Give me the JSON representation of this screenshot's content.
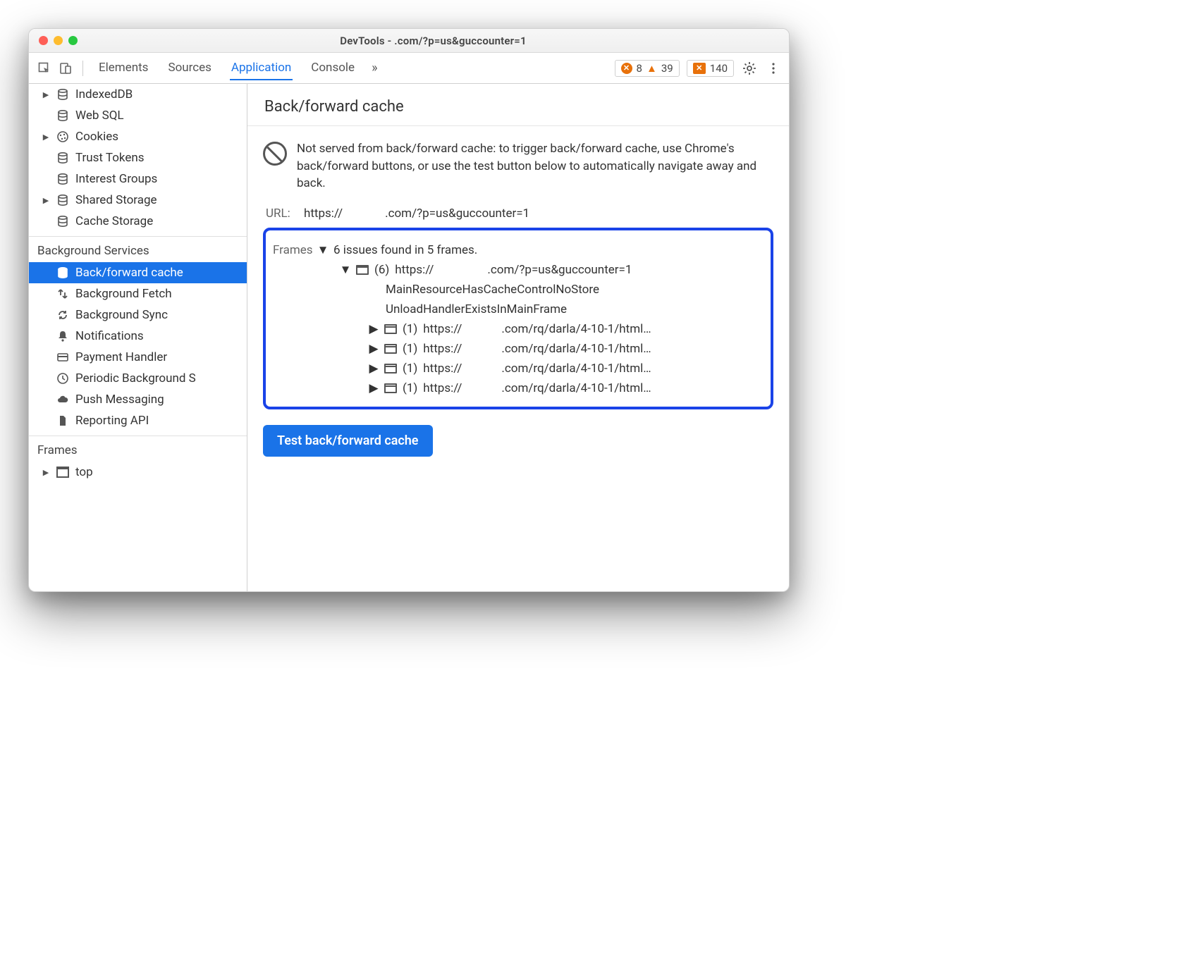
{
  "window": {
    "title": "DevTools -         .com/?p=us&guccounter=1"
  },
  "toolbar": {
    "tabs": [
      "Elements",
      "Sources",
      "Application",
      "Console"
    ],
    "active_tab": "Application",
    "more": "»",
    "errors": "8",
    "warnings": "39",
    "issues": "140"
  },
  "sidebar": {
    "storage": [
      {
        "label": "IndexedDB",
        "expandable": true,
        "icon": "db"
      },
      {
        "label": "Web SQL",
        "expandable": false,
        "icon": "db"
      },
      {
        "label": "Cookies",
        "expandable": true,
        "icon": "cookie"
      },
      {
        "label": "Trust Tokens",
        "expandable": false,
        "icon": "db"
      },
      {
        "label": "Interest Groups",
        "expandable": false,
        "icon": "db"
      },
      {
        "label": "Shared Storage",
        "expandable": true,
        "icon": "db"
      },
      {
        "label": "Cache Storage",
        "expandable": false,
        "icon": "db"
      }
    ],
    "bg_section": "Background Services",
    "bg_items": [
      {
        "label": "Back/forward cache",
        "icon": "db",
        "selected": true
      },
      {
        "label": "Background Fetch",
        "icon": "fetch"
      },
      {
        "label": "Background Sync",
        "icon": "sync"
      },
      {
        "label": "Notifications",
        "icon": "bell"
      },
      {
        "label": "Payment Handler",
        "icon": "card"
      },
      {
        "label": "Periodic Background S",
        "icon": "clock"
      },
      {
        "label": "Push Messaging",
        "icon": "cloud"
      },
      {
        "label": "Reporting API",
        "icon": "doc"
      }
    ],
    "frames_section": "Frames",
    "frames_items": [
      {
        "label": "top",
        "expandable": true
      }
    ]
  },
  "panel": {
    "heading": "Back/forward cache",
    "message": "Not served from back/forward cache: to trigger back/forward cache, use Chrome's back/forward buttons, or use the test button below to automatically navigate away and back.",
    "url_label": "URL:",
    "url_prefix": "https://",
    "url_suffix": ".com/?p=us&guccounter=1",
    "frames_label": "Frames",
    "frames_summary": "6 issues found in 5 frames.",
    "top_frame_count": "(6)",
    "top_frame_prefix": "https://",
    "top_frame_suffix": ".com/?p=us&guccounter=1",
    "reasons": [
      "MainResourceHasCacheControlNoStore",
      "UnloadHandlerExistsInMainFrame"
    ],
    "subframes": [
      {
        "count": "(1)",
        "prefix": "https://",
        "suffix": ".com/rq/darla/4-10-1/html…"
      },
      {
        "count": "(1)",
        "prefix": "https://",
        "suffix": ".com/rq/darla/4-10-1/html…"
      },
      {
        "count": "(1)",
        "prefix": "https://",
        "suffix": ".com/rq/darla/4-10-1/html…"
      },
      {
        "count": "(1)",
        "prefix": "https://",
        "suffix": ".com/rq/darla/4-10-1/html…"
      }
    ],
    "button": "Test back/forward cache"
  }
}
